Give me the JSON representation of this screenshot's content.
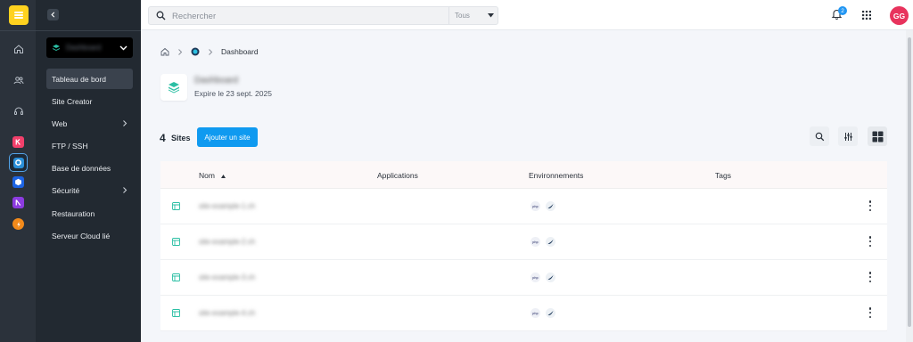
{
  "colors": {
    "accent": "#0f9af0",
    "brand_logo": "#ffd21f",
    "avatar": "#e8335d",
    "badge": "#2196f3",
    "sidebar_bg": "#222931",
    "rail_bg": "#2b323b"
  },
  "rail": {
    "logo_icon": "hosting-logo-icon",
    "icons": [
      "home-icon",
      "users-icon",
      "headset-icon"
    ],
    "apps": [
      {
        "name": "app-kmail",
        "color": "#f2406b"
      },
      {
        "name": "app-web-hosting",
        "color": "#2a8fd8"
      },
      {
        "name": "app-cloud",
        "color": "#1d64e3"
      },
      {
        "name": "app-kdrive",
        "color": "#8c3be0"
      },
      {
        "name": "app-swisstransfer",
        "color": "#f28a1b"
      }
    ]
  },
  "sidebar": {
    "selector_label": "Dashboard",
    "items": [
      {
        "label": "Tableau de bord",
        "active": true,
        "has_chevron": false
      },
      {
        "label": "Site Creator",
        "active": false,
        "has_chevron": false
      },
      {
        "label": "Web",
        "active": false,
        "has_chevron": true
      },
      {
        "label": "FTP / SSH",
        "active": false,
        "has_chevron": false
      },
      {
        "label": "Base de données",
        "active": false,
        "has_chevron": false
      },
      {
        "label": "Sécurité",
        "active": false,
        "has_chevron": true
      },
      {
        "label": "Restauration",
        "active": false,
        "has_chevron": false
      },
      {
        "label": "Serveur Cloud lié",
        "active": false,
        "has_chevron": false
      }
    ]
  },
  "topbar": {
    "search_placeholder": "Rechercher",
    "search_scope": "Tous",
    "notification_count": "2",
    "avatar_initials": "GG"
  },
  "breadcrumb": {
    "current": "Dashboard"
  },
  "site": {
    "name": "Dashboard",
    "expire": "Expire le 23 sept. 2025"
  },
  "sites_header": {
    "count": "4",
    "label": "Sites",
    "add_button": "Ajouter un site"
  },
  "table": {
    "columns": [
      "Nom",
      "Applications",
      "Environnements",
      "Tags"
    ],
    "rows": [
      {
        "name": "site-example-1.ch",
        "envs": [
          "php",
          "wordpress"
        ]
      },
      {
        "name": "site-example-2.ch",
        "envs": [
          "php",
          "wordpress"
        ]
      },
      {
        "name": "site-example-3.ch",
        "envs": [
          "php",
          "wordpress"
        ]
      },
      {
        "name": "site-example-4.ch",
        "envs": [
          "php",
          "wordpress"
        ]
      }
    ]
  }
}
